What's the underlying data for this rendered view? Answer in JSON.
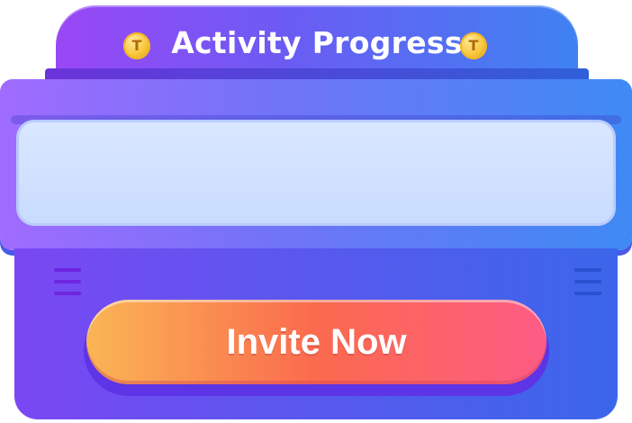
{
  "header": {
    "title": "Activity Progress",
    "coin_glyph": "T",
    "coin_icon": "gold-coin-icon"
  },
  "progress_panel": {
    "content": ""
  },
  "actions": {
    "invite_label": "Invite Now"
  },
  "colors": {
    "tab_start": "#9a47f5",
    "tab_end": "#3f82f2",
    "button_start": "#f9b554",
    "button_end": "#fd5b85",
    "panel": "#c9dcff"
  }
}
